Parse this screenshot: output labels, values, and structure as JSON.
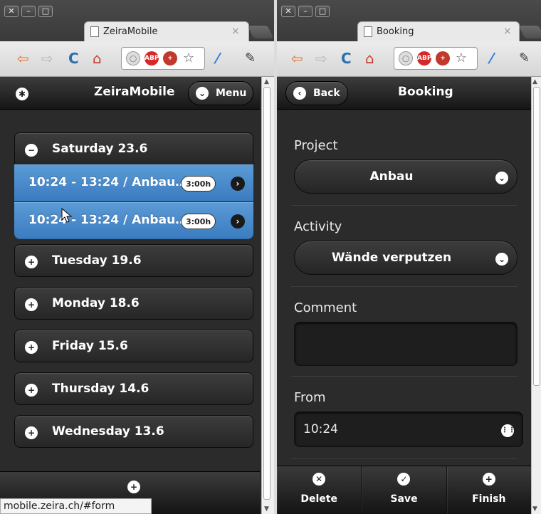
{
  "left_window": {
    "tab_title": "ZeiraMobile",
    "header": {
      "title": "ZeiraMobile",
      "menu_label": "Menu"
    },
    "days": [
      {
        "label": "Saturday 23.6",
        "expanded": true
      },
      {
        "label": "Tuesday 19.6",
        "expanded": false
      },
      {
        "label": "Monday 18.6",
        "expanded": false
      },
      {
        "label": "Friday 15.6",
        "expanded": false
      },
      {
        "label": "Thursday 14.6",
        "expanded": false
      },
      {
        "label": "Wednesday 13.6",
        "expanded": false
      }
    ],
    "entries": [
      {
        "label": "10:24 - 13:24 / Anbau…",
        "duration": "3:00h"
      },
      {
        "label": "10:24 - 13:24 / Anbau…",
        "duration": "3:00h"
      }
    ],
    "status_url": "mobile.zeira.ch/#form"
  },
  "right_window": {
    "tab_title": "Booking",
    "header": {
      "title": "Booking",
      "back_label": "Back"
    },
    "form": {
      "project_label": "Project",
      "project_value": "Anbau",
      "activity_label": "Activity",
      "activity_value": "Wände verputzen",
      "comment_label": "Comment",
      "comment_value": "",
      "from_label": "From",
      "from_value": "10:24"
    },
    "navbar": {
      "delete_label": "Delete",
      "save_label": "Save",
      "finish_label": "Finish"
    }
  },
  "icons": {
    "window_close": "✕",
    "window_minimize": "–",
    "window_maximize": "□",
    "back": "⇦",
    "forward": "⇨",
    "reload": "C",
    "home": "⌂",
    "star": "☆",
    "eyedropper": "⁄",
    "wrench": "🔧",
    "gear": "✱",
    "chevron_down": "⌄",
    "chevron_left": "‹",
    "chevron_right": "›",
    "plus": "+",
    "minus": "−",
    "check": "✓",
    "x": "✕",
    "grid": "⋮"
  },
  "colors": {
    "entry_blue": "#4a8bd0",
    "app_bg": "#2b2b2b",
    "arrow_orange": "#e8742a"
  }
}
